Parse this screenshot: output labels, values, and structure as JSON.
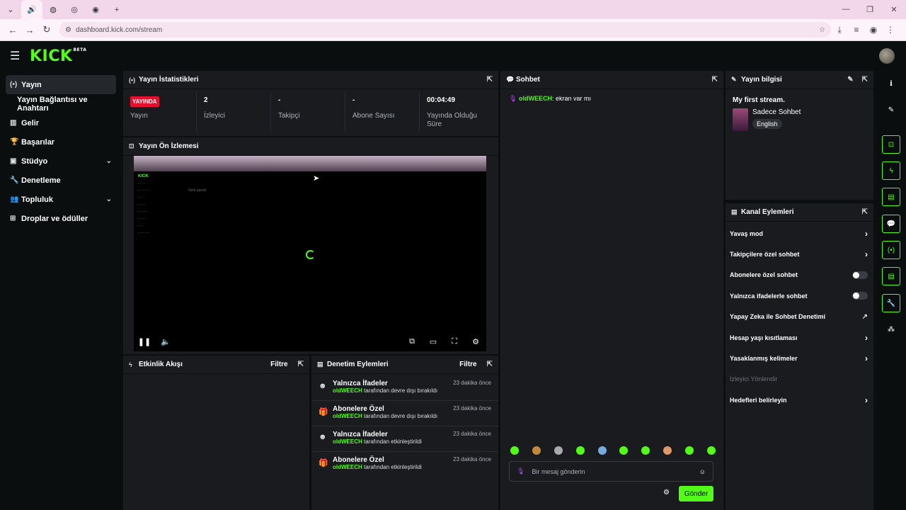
{
  "browser": {
    "tabs": [
      "🔊",
      "◍",
      "◎",
      "◉"
    ],
    "new_tab": "+",
    "url": "dashboard.kick.com/stream"
  },
  "app": {
    "logo": "KICK",
    "logo_badge": "BETA"
  },
  "sidebar": {
    "items": [
      {
        "label": "Yayın"
      },
      {
        "label": "Yayın Bağlantısı ve Anahtarı"
      },
      {
        "label": "Gelir"
      },
      {
        "label": "Başarılar"
      },
      {
        "label": "Stüdyo"
      },
      {
        "label": "Denetleme"
      },
      {
        "label": "Topluluk"
      },
      {
        "label": "Droplar ve ödüller"
      }
    ]
  },
  "stats": {
    "title": "Yayın İstatistikleri",
    "live_badge": "YAYINDA",
    "items": [
      {
        "value": "",
        "label": "Yayın"
      },
      {
        "value": "2",
        "label": "İzleyici"
      },
      {
        "value": "-",
        "label": "Takipçi"
      },
      {
        "value": "-",
        "label": "Abone Sayısı"
      },
      {
        "value": "00:04:49",
        "label": "Yayında Olduğu Süre"
      }
    ]
  },
  "preview": {
    "title": "Yayın Ön İzlemesi",
    "mini_logo": "KICK",
    "mini_heading": "Gelir paneli"
  },
  "activity": {
    "title": "Etkinlik Akışı",
    "filter": "Filtre"
  },
  "moderation": {
    "title": "Denetim Eylemleri",
    "filter": "Filtre",
    "items": [
      {
        "title": "Yalnızca İfadeler",
        "user": "oldWEECH",
        "action": "tarafından devre dışı bırakıldı",
        "time": "23 dakika önce"
      },
      {
        "title": "Abonelere Özel",
        "user": "oldWEECH",
        "action": "tarafından devre dışı bırakıldı",
        "time": "23 dakika önce"
      },
      {
        "title": "Yalnızca İfadeler",
        "user": "oldWEECH",
        "action": "tarafından etkinleştirildi",
        "time": "23 dakika önce"
      },
      {
        "title": "Abonelere Özel",
        "user": "oldWEECH",
        "action": "tarafından etkinleştirildi",
        "time": "23 dakika önce"
      }
    ]
  },
  "chat": {
    "title": "Sohbet",
    "messages": [
      {
        "user": "oldWEECH",
        "text": "ekran var mı"
      }
    ],
    "placeholder": "Bir mesaj gönderin",
    "send": "Gönder"
  },
  "stream_info": {
    "title": "Yayın bilgisi",
    "stream_title": "My first stream.",
    "category": "Sadece Sohbet",
    "language": "English"
  },
  "channel_actions": {
    "title": "Kanal Eylemleri",
    "items": [
      {
        "label": "Yavaş mod",
        "control": "chevron"
      },
      {
        "label": "Takipçilere özel sohbet",
        "control": "chevron"
      },
      {
        "label": "Abonelere özel sohbet",
        "control": "toggle",
        "on": false
      },
      {
        "label": "Yalnızca ifadelerle sohbet",
        "control": "toggle",
        "on": false
      },
      {
        "label": "Yapay Zeka ile Sohbet Denetimi",
        "control": "external"
      },
      {
        "label": "Hesap yaşı kısıtlaması",
        "control": "chevron"
      },
      {
        "label": "Yasaklanmış kelimeler",
        "control": "chevron"
      },
      {
        "label": "İzleyici Yönlendir",
        "control": "none"
      },
      {
        "label": "Hedefleri belirleyin",
        "control": "chevron"
      }
    ]
  },
  "colors": {
    "accent": "#53fc18",
    "live": "#e5102d",
    "panel": "#191b1f",
    "bg": "#0b0e0f"
  }
}
